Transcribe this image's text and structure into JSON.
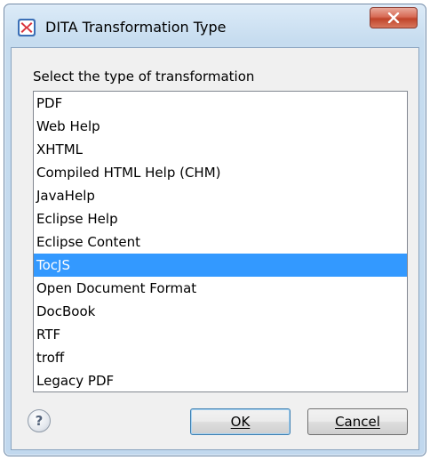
{
  "window": {
    "title": "DITA Transformation Type"
  },
  "dialog": {
    "prompt": "Select the type of transformation",
    "items": [
      "PDF",
      "Web Help",
      "XHTML",
      "Compiled HTML Help (CHM)",
      "JavaHelp",
      "Eclipse Help",
      "Eclipse Content",
      "TocJS",
      "Open Document Format",
      "DocBook",
      "RTF",
      "troff",
      "Legacy PDF"
    ],
    "selected_item": "TocJS"
  },
  "buttons": {
    "help_label": "?",
    "ok_label": "OK",
    "cancel_label": "Cancel"
  },
  "icons": {
    "app": "oxygen-x-icon",
    "close": "close-icon",
    "help": "help-icon"
  },
  "colors": {
    "selection": "#3399ff",
    "close_button": "#c7472c",
    "app_icon": "#d9323a"
  }
}
